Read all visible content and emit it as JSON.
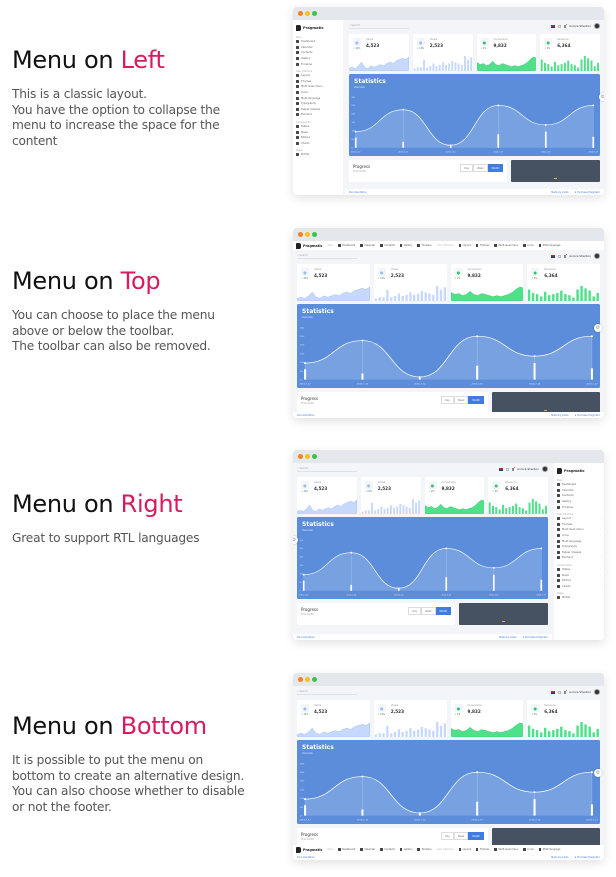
{
  "sections": [
    {
      "id": "left",
      "heading_prefix": "Menu on",
      "heading_accent": "Left",
      "description_lines": [
        "This is a classic layout.",
        "You have the option to collapse the",
        "menu to increase the space for the",
        "content"
      ],
      "layout": "left"
    },
    {
      "id": "top",
      "heading_prefix": "Menu on",
      "heading_accent": "Top",
      "description_lines": [
        "You can choose to place the menu",
        "above or below the toolbar.",
        "The toolbar can also be removed."
      ],
      "layout": "top"
    },
    {
      "id": "right",
      "heading_prefix": "Menu on",
      "heading_accent": "Right",
      "description_lines": [
        "Great to support RTL languages"
      ],
      "layout": "right"
    },
    {
      "id": "bottom",
      "heading_prefix": "Menu on",
      "heading_accent": "Bottom",
      "description_lines": [
        "It is possible to put the menu on",
        "bottom to create an alternative design.",
        "You can also choose whether to disable",
        "or not the footer."
      ],
      "layout": "bottom"
    }
  ],
  "dashboard": {
    "brand": "Pragmatic",
    "search_placeholder": "Search",
    "user_name": "Aurora Shenton",
    "sidebar_groups": [
      {
        "label": "Main",
        "items": [
          {
            "label": "Dashboard",
            "icon": "gauge-icon",
            "chevron": false
          },
          {
            "label": "Calendar",
            "icon": "calendar-icon",
            "chevron": false
          },
          {
            "label": "Contacts",
            "icon": "contacts-icon",
            "chevron": false
          },
          {
            "label": "Gallery",
            "icon": "image-icon",
            "chevron": false
          },
          {
            "label": "Timeline",
            "icon": "timeline-icon",
            "chevron": false
          }
        ]
      },
      {
        "label": "User interface",
        "items": [
          {
            "label": "Layout",
            "icon": "layout-icon",
            "chevron": true
          },
          {
            "label": "Themes",
            "icon": "brush-icon",
            "chevron": false
          },
          {
            "label": "Multi level menu",
            "icon": "menu-icon",
            "chevron": true
          },
          {
            "label": "Icons",
            "icon": "icons-icon",
            "chevron": true
          },
          {
            "label": "Multi language",
            "icon": "translate-icon",
            "chevron": false
          },
          {
            "label": "Typography",
            "icon": "typography-icon",
            "chevron": false
          },
          {
            "label": "Helper Classes",
            "icon": "help-icon",
            "chevron": false
          },
          {
            "label": "Element",
            "icon": "element-icon",
            "chevron": true
          }
        ]
      },
      {
        "label": "Components",
        "items": [
          {
            "label": "Tables",
            "icon": "table-icon",
            "chevron": true
          },
          {
            "label": "Maps",
            "icon": "map-icon",
            "chevron": true
          },
          {
            "label": "Editors",
            "icon": "editor-icon",
            "chevron": true
          },
          {
            "label": "Charts",
            "icon": "chart-icon",
            "chevron": true
          }
        ]
      },
      {
        "label": "Pages",
        "items": [
          {
            "label": "Profile",
            "icon": "profile-icon",
            "chevron": false
          }
        ]
      }
    ],
    "top_menu": [
      {
        "label": "Dashboard",
        "type": "item"
      },
      {
        "label": "Calendar",
        "type": "item"
      },
      {
        "label": "Contacts",
        "type": "item"
      },
      {
        "label": "Gallery",
        "type": "item"
      },
      {
        "label": "Timeline",
        "type": "item"
      },
      {
        "label": "User interface",
        "type": "group"
      },
      {
        "label": "Layout",
        "type": "item"
      },
      {
        "label": "Themes",
        "type": "item"
      },
      {
        "label": "Multi level menu",
        "type": "item"
      },
      {
        "label": "Icons",
        "type": "item"
      },
      {
        "label": "Multi language",
        "type": "item"
      }
    ],
    "top_menu_group_main": "Main",
    "stat_cards": [
      {
        "label": "Users",
        "value": "4,523",
        "change": "12%",
        "icon": "users-icon",
        "chart": "area",
        "color": "#c6d8fb",
        "stroke": "#9bbcf3",
        "series": [
          2,
          3,
          2,
          4,
          7,
          3,
          2,
          4,
          3,
          4,
          5,
          4,
          6,
          7,
          6,
          8,
          9,
          10,
          9,
          11
        ]
      },
      {
        "label": "Views",
        "value": "2,523",
        "change": "12%",
        "icon": "eye-icon",
        "chart": "bars",
        "color": "#c6d8fb",
        "stroke": "#9bbcf3",
        "series": [
          2,
          3,
          3,
          9,
          3,
          4,
          6,
          4,
          5,
          7,
          5,
          6,
          8,
          7,
          6,
          5,
          12,
          9,
          11
        ]
      },
      {
        "label": "Conversion",
        "value": "9,832",
        "change": "2%",
        "icon": "dollar-icon",
        "chart": "area",
        "color": "#4fe08a",
        "stroke": "#2fc46c",
        "series": [
          8,
          6,
          7,
          5,
          6,
          9,
          6,
          5,
          7,
          6,
          5,
          4,
          5,
          4,
          5,
          6,
          8,
          11,
          13,
          12
        ]
      },
      {
        "label": "Revenue",
        "value": "6,364",
        "change": "2%",
        "icon": "money-icon",
        "chart": "bars",
        "color": "#4fe08a",
        "stroke": "#2fc46c",
        "series": [
          10,
          7,
          6,
          4,
          8,
          5,
          6,
          7,
          9,
          6,
          5,
          3,
          10,
          13,
          11,
          9,
          4,
          7
        ]
      }
    ],
    "statistics": {
      "title": "Statistics",
      "subtitle": "Overview",
      "x_labels": [
        "2016-7-12",
        "2016-7-13",
        "2016-7-14",
        "2016-7-15",
        "2016-7-16",
        "2016-7-17",
        "2016-7-18"
      ],
      "line_values": [
        95,
        225,
        15,
        250,
        135,
        250
      ],
      "bar_values": [
        60,
        35,
        10,
        80,
        95,
        65
      ],
      "y_max": 300
    },
    "progress": {
      "title": "Progress",
      "subtitle": "This month",
      "tabs": [
        "Day",
        "Week",
        "Month"
      ],
      "active_tab": "Month"
    },
    "footer": {
      "left": "Documentation",
      "right_1": "Made by Linkle",
      "right_2": "Purchase Pragmatic"
    }
  }
}
